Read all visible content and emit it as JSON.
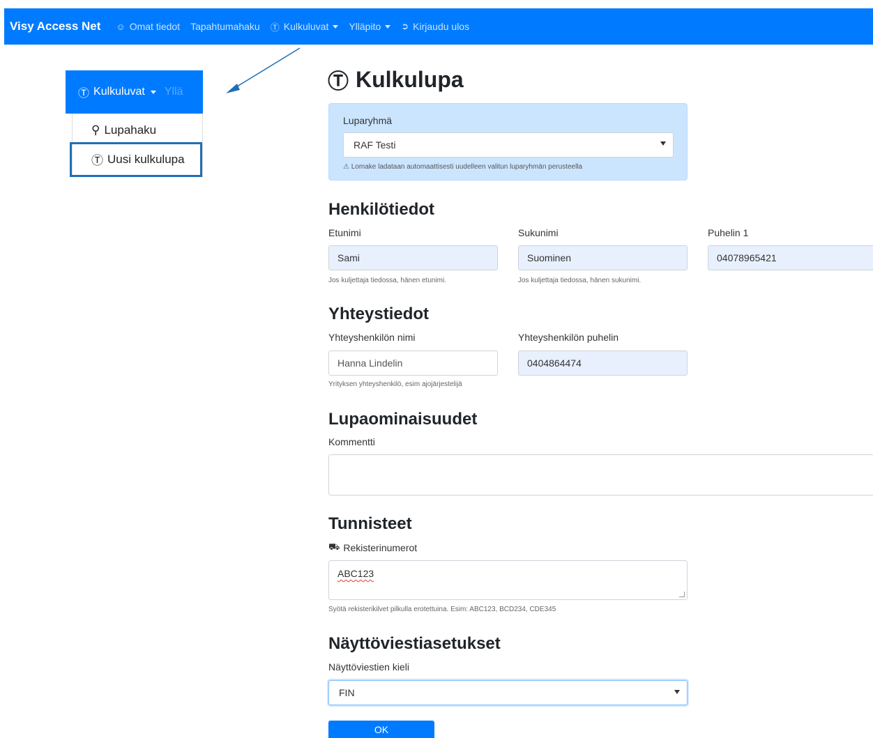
{
  "navbar": {
    "brand": "Visy Access Net",
    "items": [
      {
        "label": "Omat tiedot",
        "icon": "user-circle-icon"
      },
      {
        "label": "Tapahtumahaku"
      },
      {
        "label": "Kulkuluvat",
        "icon": "accessibility-icon",
        "dropdown": true
      },
      {
        "label": "Ylläpito",
        "dropdown": true
      },
      {
        "label": "Kirjaudu ulos",
        "icon": "sign-out-icon"
      }
    ]
  },
  "inset": {
    "menu_label": "Kulkuluvat",
    "faded_label": "Yllä",
    "items": [
      {
        "label": "Lupahaku",
        "icon": "search-icon"
      },
      {
        "label": "Uusi kulkulupa",
        "icon": "accessibility-icon"
      }
    ]
  },
  "page": {
    "title": "Kulkulupa"
  },
  "permit_group": {
    "label": "Luparyhmä",
    "selected": "RAF Testi",
    "note": "Lomake ladataan automaattisesti uudelleen valitun luparyhmän perusteella"
  },
  "person": {
    "heading": "Henkilötiedot",
    "first_name_label": "Etunimi",
    "first_name_value": "Sami",
    "first_name_help": "Jos kuljettaja tiedossa, hänen etunimi.",
    "last_name_label": "Sukunimi",
    "last_name_value": "Suominen",
    "last_name_help": "Jos kuljettaja tiedossa, hänen sukunimi.",
    "phone_label": "Puhelin 1",
    "phone_value": "04078965421"
  },
  "contact": {
    "heading": "Yhteystiedot",
    "name_label": "Yhteyshenkilön nimi",
    "name_value": "Hanna Lindelin",
    "name_help": "Yrityksen yhteyshenkilö, esim ajojärjestelijä",
    "phone_label": "Yhteyshenkilön puhelin",
    "phone_value": "0404864474"
  },
  "properties": {
    "heading": "Lupaominaisuudet",
    "comment_label": "Kommentti",
    "comment_value": ""
  },
  "identifiers": {
    "heading": "Tunnisteet",
    "plates_label": "Rekisterinumerot",
    "plates_value": "ABC123",
    "plates_help": "Syötä rekisterikilvet pilkulla erotettuina. Esim: ABC123, BCD234, CDE345"
  },
  "display": {
    "heading": "Näyttöviestiasetukset",
    "language_label": "Näyttöviestien kieli",
    "language_value": "FIN"
  },
  "actions": {
    "ok_label": "OK"
  },
  "colors": {
    "primary": "#007bff",
    "highlight_border": "#1f6fb5",
    "alert_bg": "#cce5ff",
    "autofill_bg": "#e8f0fe"
  }
}
